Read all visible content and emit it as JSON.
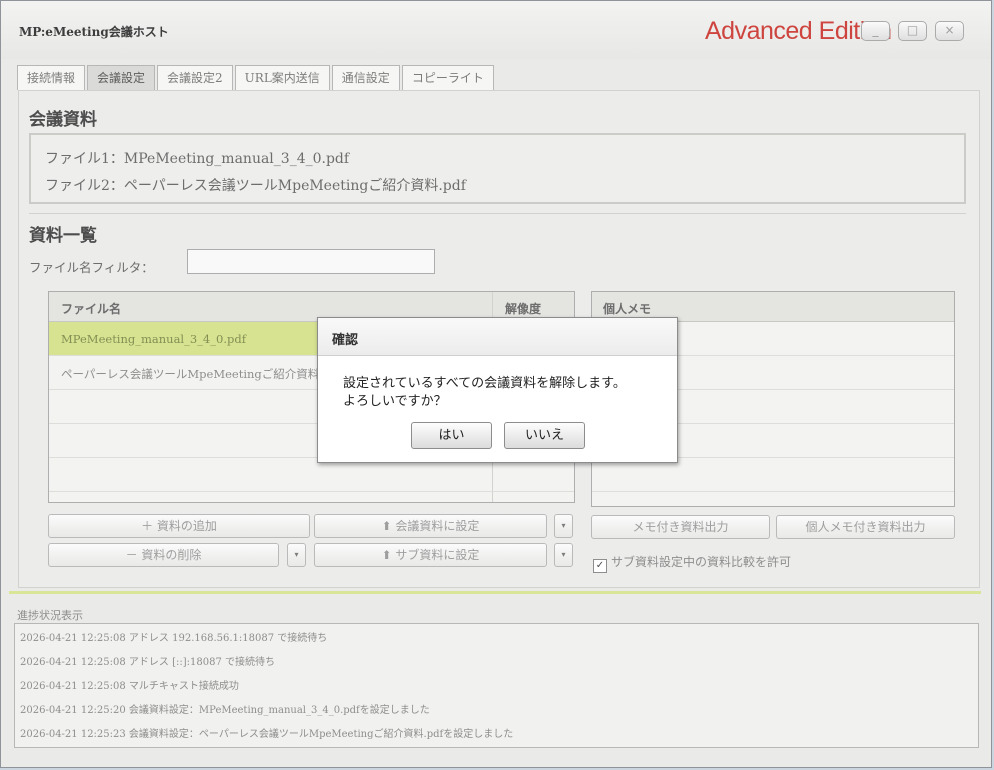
{
  "window": {
    "title": "MP:eMeeting会議ホスト",
    "edition": "Advanced Edition",
    "controls": [
      "_",
      "□",
      "×"
    ]
  },
  "tabs": [
    "接続情報",
    "会議設定",
    "会議設定2",
    "URL案内送信",
    "通信設定",
    "コピーライト"
  ],
  "active_tab": "会議設定",
  "meeting_docs": {
    "heading": "会議資料",
    "file1": "ファイル1：MPeMeeting_manual_3_4_0.pdf",
    "file2": "ファイル2：ペーパーレス会議ツールMpeMeetingご紹介資料.pdf"
  },
  "doc_list": {
    "heading": "資料一覧",
    "filter_label": "ファイル名フィルタ：",
    "filter_value": "",
    "columns": {
      "name": "ファイル名",
      "resolution": "解像度"
    },
    "rows": [
      {
        "name": "MPeMeeting_manual_3_4_0.pdf",
        "resolution": ""
      },
      {
        "name": "ペーパーレス会議ツールMpeMeetingご紹介資料.pdf",
        "resolution": ""
      }
    ],
    "memo_header": "個人メモ"
  },
  "buttons": {
    "add": "＋ 資料の追加",
    "remove": "－ 資料の削除",
    "set_meeting": "⬆ 会議資料に設定",
    "set_sub": "⬆ サブ資料に設定",
    "memo_export": "メモ付き資料出力",
    "personal_memo_export": "個人メモ付き資料出力",
    "dropdown": "▾"
  },
  "allow_compare": {
    "label": "サブ資料設定中の資料比較を許可",
    "checked": true
  },
  "progress": {
    "label": "進捗状況表示",
    "logs": [
      "2026-04-21 12:25:08 アドレス 192.168.56.1:18087 で接続待ち",
      "2026-04-21 12:25:08 アドレス [::]:18087 で接続待ち",
      "2026-04-21 12:25:08 マルチキャスト接続成功",
      "2026-04-21 12:25:20 会議資料設定：MPeMeeting_manual_3_4_0.pdfを設定しました",
      "2026-04-21 12:25:23 会議資料設定：ペーパーレス会議ツールMpeMeetingご紹介資料.pdfを設定しました"
    ]
  },
  "dialog": {
    "title": "確認",
    "message_line1": "設定されているすべての会議資料を解除します。",
    "message_line2": "よろしいですか？",
    "yes": "はい",
    "no": "いいえ"
  }
}
